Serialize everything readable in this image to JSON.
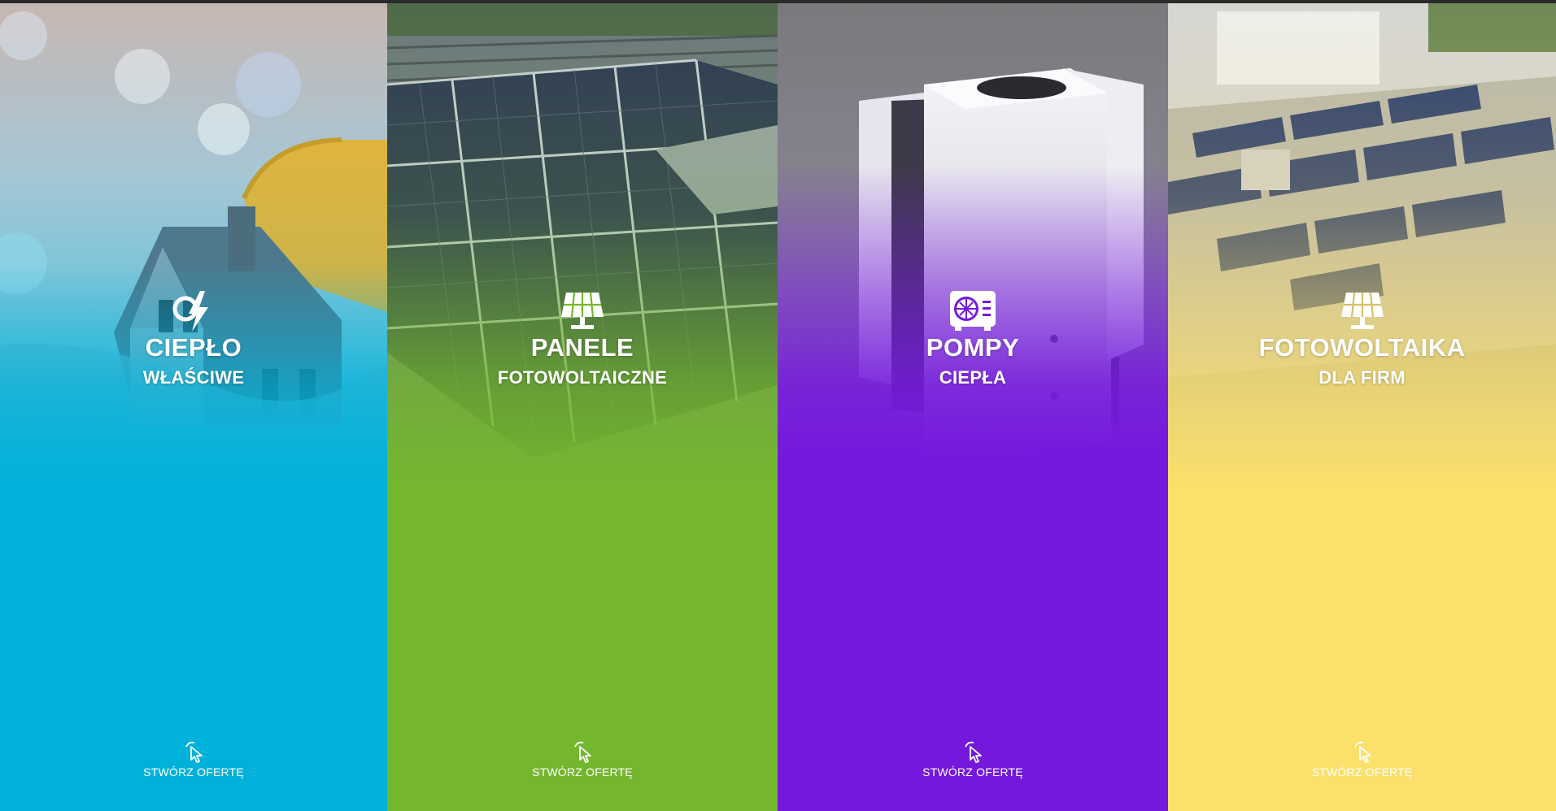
{
  "panels": [
    {
      "title": "CIEPŁO",
      "subtitle": "WŁAŚCIWE",
      "icon": "warm-energy-icon",
      "cta": "STWÓRZ OFERTĘ",
      "color": "#00b1d9"
    },
    {
      "title": "PANELE",
      "subtitle": "FOTOWOLTAICZNE",
      "icon": "solar-panel-icon",
      "cta": "STWÓRZ OFERTĘ",
      "color": "#74b72e"
    },
    {
      "title": "POMPY",
      "subtitle": "CIEPŁA",
      "icon": "heat-pump-icon",
      "cta": "STWÓRZ OFERTĘ",
      "color": "#7419dc"
    },
    {
      "title": "FOTOWOLTAIKA",
      "subtitle": "DLA FIRM",
      "icon": "solar-panel-icon",
      "cta": "STWÓRZ OFERTĘ",
      "color": "#fce06c"
    }
  ]
}
